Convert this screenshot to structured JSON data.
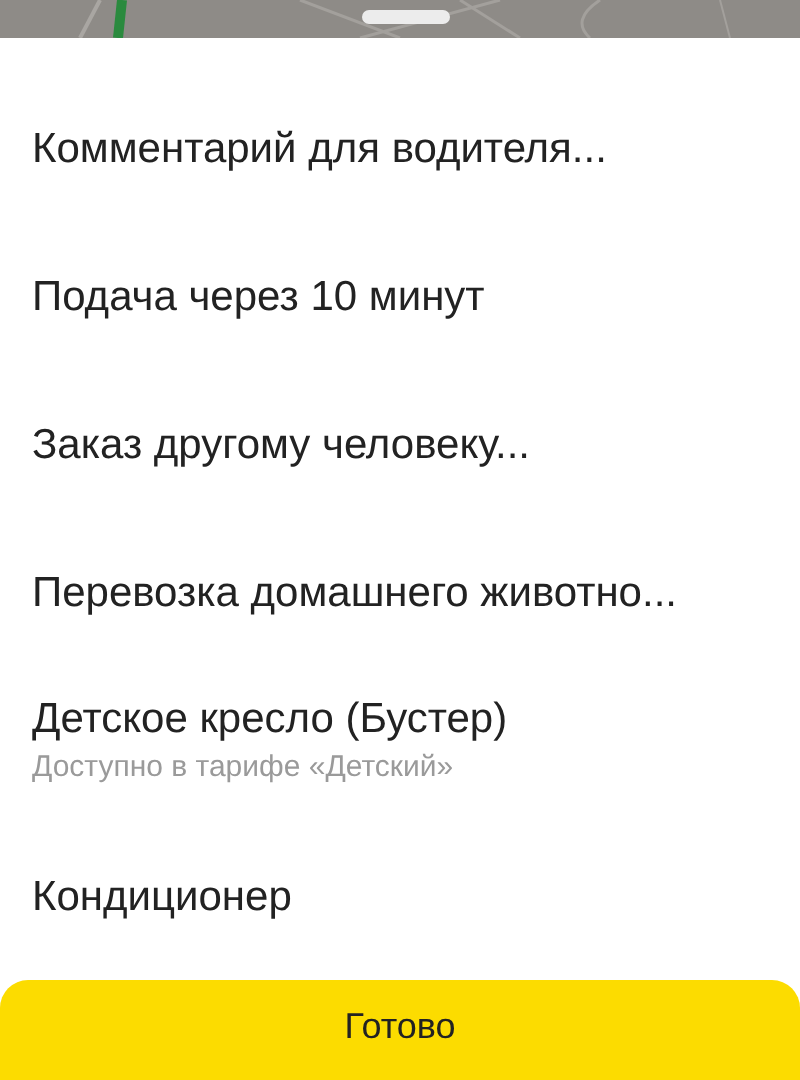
{
  "options": [
    {
      "title": "Комментарий для водителя..."
    },
    {
      "title": "Подача через 10 минут"
    },
    {
      "title": "Заказ другому человеку..."
    },
    {
      "title": "Перевозка домашнего животно..."
    },
    {
      "title": "Детское кресло (Бустер)",
      "note": "Доступно в тарифе «Детский»"
    },
    {
      "title": "Кондиционер"
    }
  ],
  "done_button": "Готово"
}
